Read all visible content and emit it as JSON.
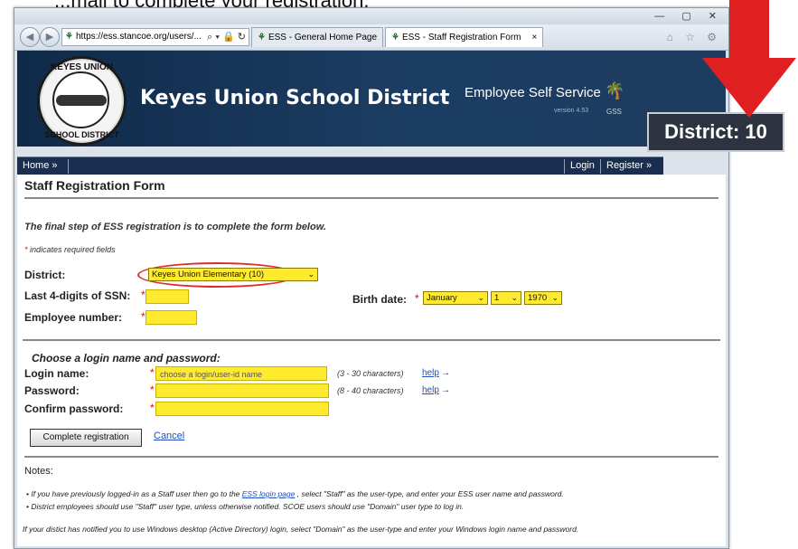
{
  "caption": {
    "text": "...mail to complete your registration."
  },
  "browser": {
    "address": "https://ess.stancoe.org/users/...",
    "tabs": [
      {
        "label": "ESS - General Home Page"
      },
      {
        "label": "ESS - Staff Registration Form",
        "close": "×"
      }
    ],
    "window_controls": "— ▢ ✕"
  },
  "banner": {
    "seal_top": "KEYES UNION",
    "seal_bottom": "SCHOOL DISTRICT",
    "district_name": "Keyes Union School District",
    "ess_title": "Employee Self Service",
    "ess_version": "version 4.53",
    "ess_logo_text": "GSS"
  },
  "nav": {
    "home": "Home »",
    "login": "Login",
    "register": "Register »"
  },
  "badge": {
    "text": "District: 10"
  },
  "form": {
    "title": "Staff Registration Form",
    "intro": "The final step of ESS registration is to complete the form below.",
    "required_note": "indicates required fields",
    "required_star": "*",
    "district_label": "District:",
    "district_value": "Keyes Union Elementary (10)",
    "ssn_label": "Last 4-digits of SSN:",
    "birth_label": "Birth date:",
    "birth_month": "January",
    "birth_day": "1",
    "birth_year": "1970",
    "employee_label": "Employee number:",
    "section_title": "Choose a login name and password:",
    "login_label": "Login name:",
    "login_placeholder": "choose a login/user-id name",
    "login_hint": "(3 - 30 characters)",
    "password_label": "Password:",
    "password_hint": "(8 - 40 characters)",
    "confirm_label": "Confirm password:",
    "help_label": "help",
    "help_arrow": "→",
    "submit_label": "Complete registration",
    "cancel_label": "Cancel"
  },
  "notes": {
    "title": "Notes:",
    "note1_pre": "• If you have previously logged-in as a Staff user then go to the ",
    "note1_link": "ESS login page",
    "note1_post": " , select \"Staff\" as the user-type, and enter your ESS user name and password.",
    "note2": "• District employees should use \"Staff\" user type, unless otherwise notified. SCOE users should use \"Domain\" user type to log in.",
    "footnote": "If your distict has notified you to use Windows desktop (Active Directory) login, select \"Domain\" as the user-type and enter your Windows login name and password."
  },
  "colors": {
    "highlight": "#ffea2e",
    "banner": "#1c3d63",
    "arrow": "#e02020",
    "annotation": "#e12a2a"
  }
}
